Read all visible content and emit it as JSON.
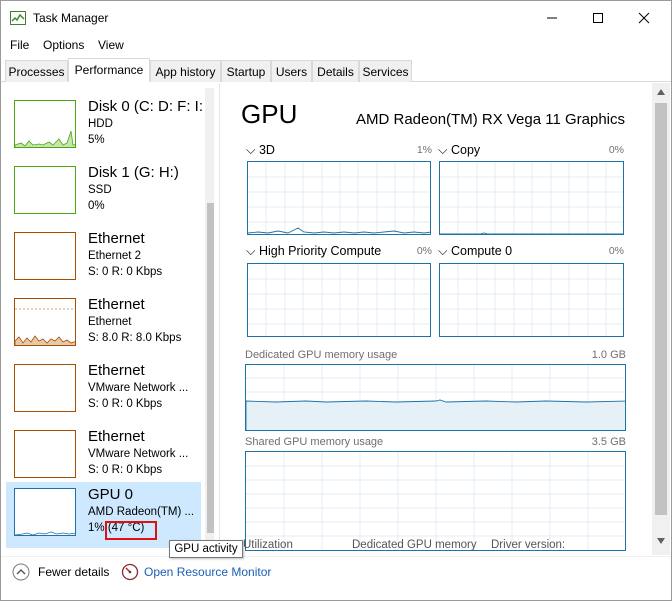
{
  "window": {
    "title": "Task Manager"
  },
  "menu": [
    "File",
    "Options",
    "View"
  ],
  "tabs": [
    "Processes",
    "Performance",
    "App history",
    "Startup",
    "Users",
    "Details",
    "Services"
  ],
  "sidebar": {
    "items": [
      {
        "name": "Disk 0 (C: D: F: I:",
        "sub": "HDD",
        "value": "5%",
        "kind": "disk"
      },
      {
        "name": "Disk 1 (G: H:)",
        "sub": "SSD",
        "value": "0%",
        "kind": "disk"
      },
      {
        "name": "Ethernet",
        "sub": "Ethernet 2",
        "value": "S: 0 R: 0 Kbps",
        "kind": "eth"
      },
      {
        "name": "Ethernet",
        "sub": "Ethernet",
        "value": "S: 8.0 R: 8.0 Kbps",
        "kind": "eth"
      },
      {
        "name": "Ethernet",
        "sub": "VMware Network ...",
        "value": "S: 0 R: 0 Kbps",
        "kind": "eth"
      },
      {
        "name": "Ethernet",
        "sub": "VMware Network ...",
        "value": "S: 0 R: 0 Kbps",
        "kind": "eth"
      },
      {
        "name": "GPU 0",
        "sub": "AMD Radeon(TM) ...",
        "value": "1%",
        "temp": "(47 °C)",
        "kind": "gpu",
        "selected": true
      }
    ]
  },
  "main": {
    "title": "GPU",
    "model": "AMD Radeon(TM) RX Vega 11 Graphics",
    "engines": [
      {
        "label": "3D",
        "pct": "1%"
      },
      {
        "label": "Copy",
        "pct": "0%"
      },
      {
        "label": "High Priority Compute",
        "pct": "0%"
      },
      {
        "label": "Compute 0",
        "pct": "0%"
      }
    ],
    "dedicated_label": "Dedicated GPU memory usage",
    "dedicated_max": "1.0 GB",
    "shared_label": "Shared GPU memory usage",
    "shared_max": "3.5 GB",
    "bottom_labels": [
      "Utilization",
      "Dedicated GPU memory",
      "Driver version:"
    ]
  },
  "tooltip": "GPU activity",
  "footer": {
    "fewer_details": "Fewer details",
    "open_monitor": "Open Resource Monitor"
  },
  "colors": {
    "gpu_accent": "#1c73a8",
    "disk_accent": "#4da60c",
    "eth_accent": "#a74f01",
    "selection": "#cde8ff",
    "highlight": "#e01010"
  },
  "icons": {
    "app": "task-manager-icon",
    "minimize": "minimize-icon",
    "maximize": "maximize-icon",
    "close": "close-icon",
    "fewer": "chevron-up-icon",
    "monitor": "resource-monitor-icon"
  }
}
